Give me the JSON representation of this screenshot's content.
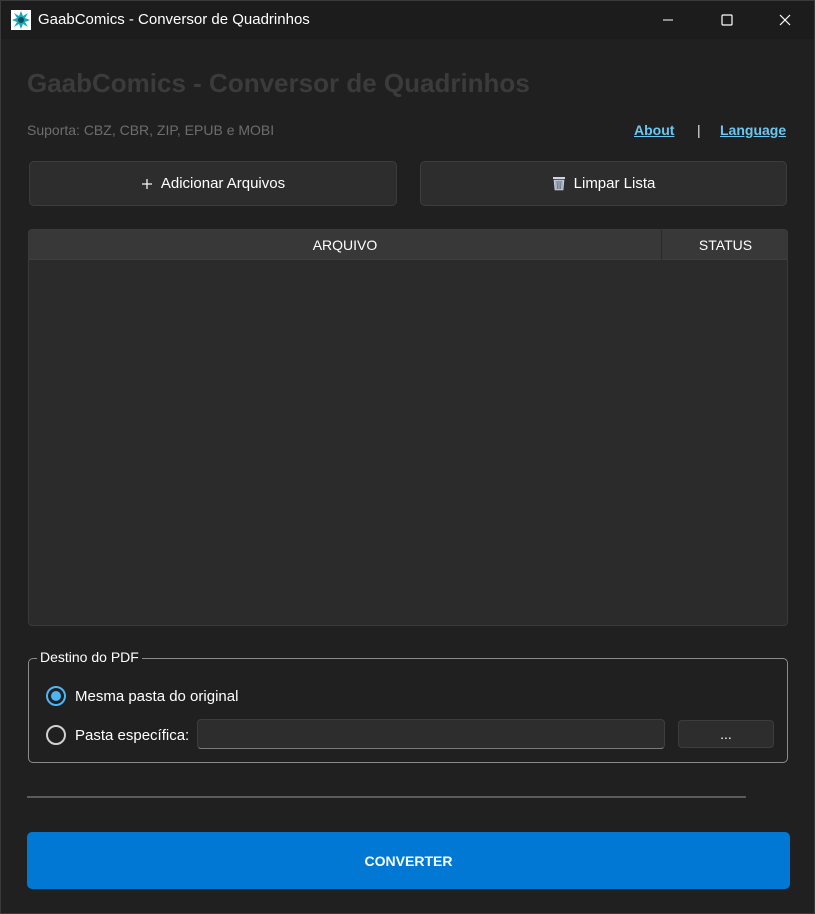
{
  "window": {
    "title": "GaabComics - Conversor de Quadrinhos",
    "icon": "comic-burst-icon"
  },
  "header": {
    "app_title": "GaabComics - Conversor de Quadrinhos",
    "supports": "Suporta: CBZ, CBR, ZIP, EPUB e MOBI",
    "about_label": "About",
    "separator": "|",
    "language_label": "Language"
  },
  "toolbar": {
    "add_label": "Adicionar Arquivos",
    "add_icon": "plus-icon",
    "clear_label": "Limpar Lista",
    "clear_icon": "wastebasket-icon"
  },
  "file_table": {
    "columns": [
      "ARQUIVO",
      "STATUS"
    ],
    "rows": []
  },
  "destination": {
    "legend": "Destino do PDF",
    "option_same": "Mesma pasta do original",
    "option_specific": "Pasta específica:",
    "selected": "same",
    "path_value": "",
    "browse_label": "..."
  },
  "progress": {
    "value": 0
  },
  "actions": {
    "convert_label": "CONVERTER"
  },
  "colors": {
    "accent": "#0078d4",
    "link": "#6cc7f0",
    "radio_selected": "#4db5f3",
    "background": "#202020"
  }
}
